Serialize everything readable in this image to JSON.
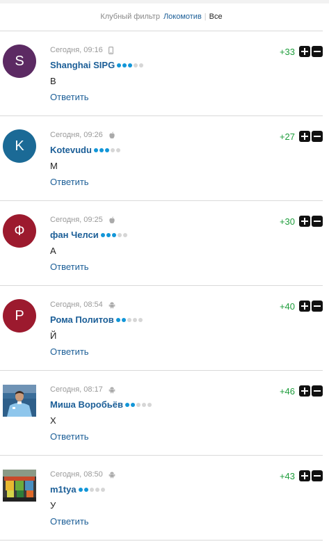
{
  "filter": {
    "label": "Клубный фильтр",
    "club": "Локомотив",
    "all": "Все"
  },
  "comments": [
    {
      "time": "Сегодня, 09:16",
      "device": "mobile-icon",
      "author": "Shanghai SIPG",
      "level": 3,
      "text": "В",
      "reply": "Ответить",
      "score": "+33",
      "avatar_letter": "S",
      "avatar_color": "#5c2a63"
    },
    {
      "time": "Сегодня, 09:26",
      "device": "apple-icon",
      "author": "Kotevudu",
      "level": 3,
      "text": "М",
      "reply": "Ответить",
      "score": "+27",
      "avatar_letter": "K",
      "avatar_color": "#1b6a96"
    },
    {
      "time": "Сегодня, 09:25",
      "device": "apple-icon",
      "author": "фан Челси",
      "level": 3,
      "text": "А",
      "reply": "Ответить",
      "score": "+30",
      "avatar_letter": "Ф",
      "avatar_color": "#9c1a2e"
    },
    {
      "time": "Сегодня, 08:54",
      "device": "android-icon",
      "author": "Рома Политов",
      "level": 2,
      "text": "Й",
      "reply": "Ответить",
      "score": "+40",
      "avatar_letter": "Р",
      "avatar_color": "#9c1a2e"
    },
    {
      "time": "Сегодня, 08:17",
      "device": "android-icon",
      "author": "Миша Воробьёв",
      "level": 2,
      "text": "Х",
      "reply": "Ответить",
      "score": "+46",
      "avatar_letter": "",
      "avatar_color": "#6aa5d8"
    },
    {
      "time": "Сегодня, 08:50",
      "device": "android-icon",
      "author": "m1tya",
      "level": 2,
      "text": "У",
      "reply": "Ответить",
      "score": "+43",
      "avatar_letter": "",
      "avatar_color": "#555555"
    }
  ]
}
